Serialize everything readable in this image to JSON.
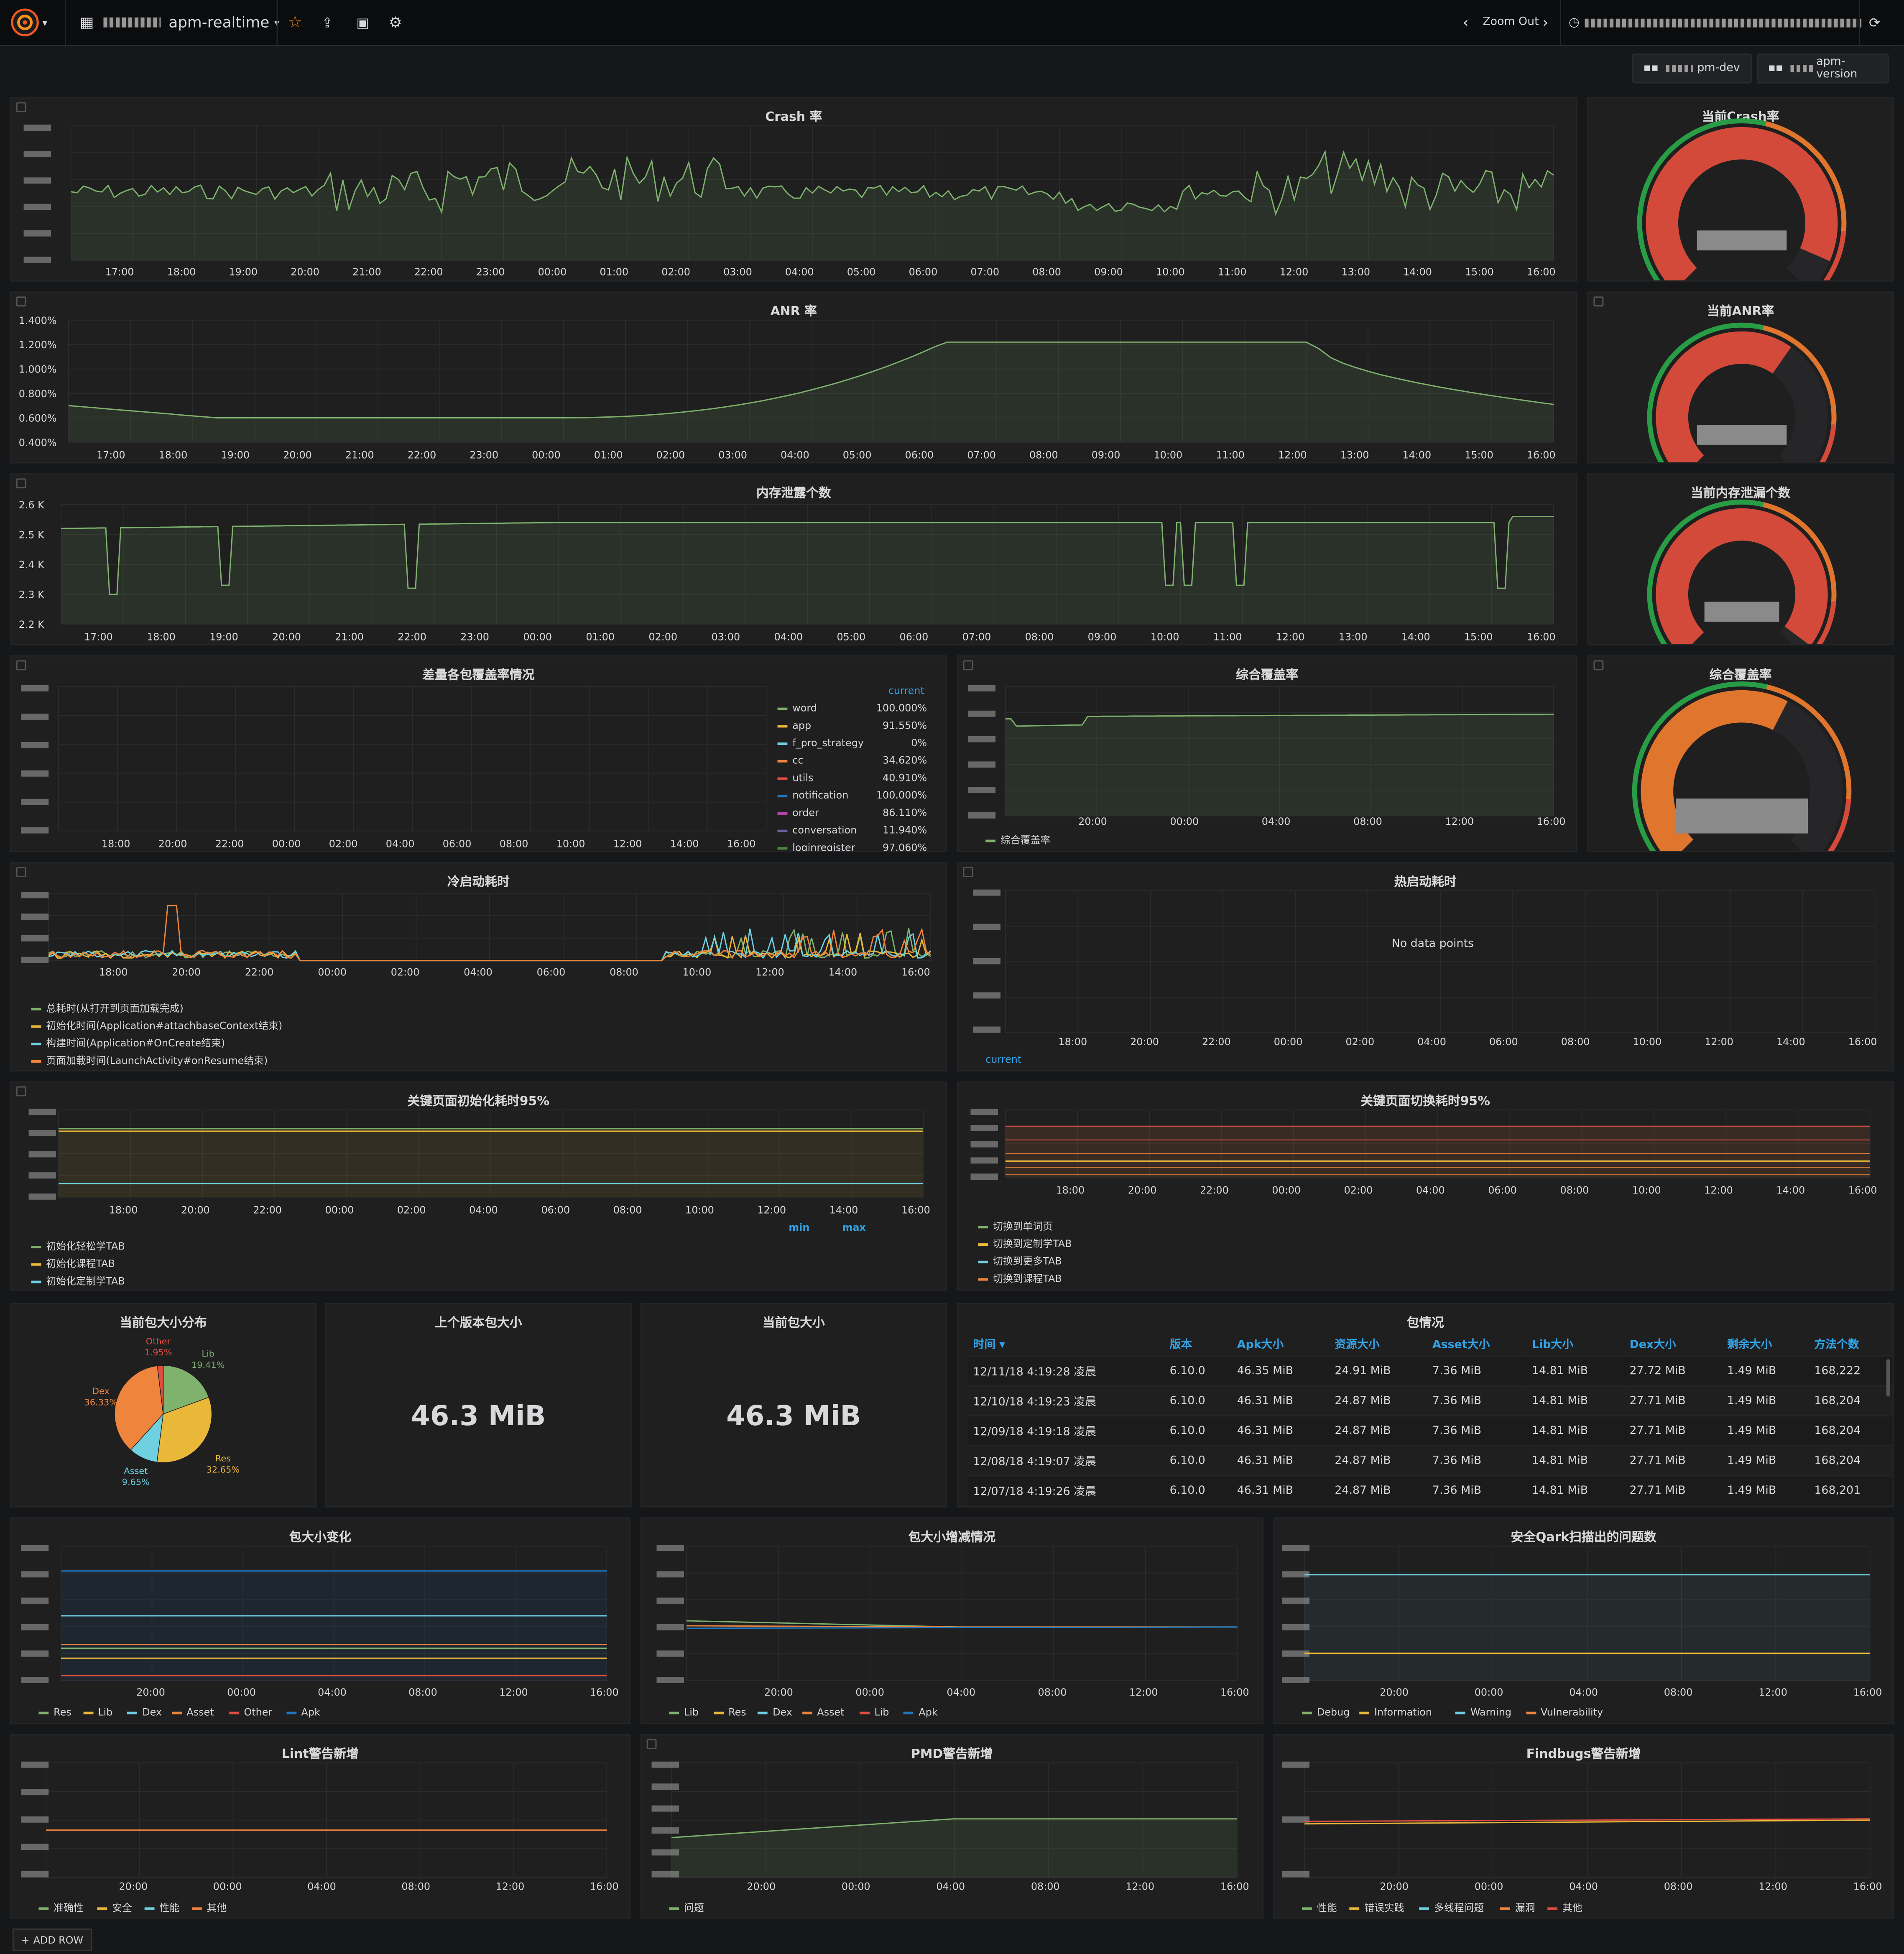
{
  "topbar": {
    "dashboard_title": "apm-realtime",
    "zoom_out": "Zoom Out"
  },
  "variables": [
    {
      "label": "pm-dev"
    },
    {
      "label": "apm-version"
    }
  ],
  "colors": {
    "green": "#7eb26d",
    "yellow": "#eab839",
    "cyan": "#6ed0e0",
    "orange": "#ef843c",
    "red": "#e24d42",
    "blue": "#1f78c1",
    "purple": "#ba43a9",
    "violet": "#705da0",
    "gauge_red": "#d44a3a",
    "gauge_orange": "#e0752d",
    "gauge_green": "#299c46",
    "accent": "#33a2e5"
  },
  "panels": {
    "crash": {
      "title": "Crash 率",
      "xticks": [
        "17:00",
        "18:00",
        "19:00",
        "20:00",
        "21:00",
        "22:00",
        "23:00",
        "00:00",
        "01:00",
        "02:00",
        "03:00",
        "04:00",
        "05:00",
        "06:00",
        "07:00",
        "08:00",
        "09:00",
        "10:00",
        "11:00",
        "12:00",
        "13:00",
        "14:00",
        "15:00",
        "16:00"
      ]
    },
    "crash_gauge": {
      "title": "当前Crash率",
      "value_fraction": 0.92
    },
    "anr": {
      "title": "ANR 率",
      "yticks": [
        "1.400%",
        "1.200%",
        "1.000%",
        "0.800%",
        "0.600%",
        "0.400%"
      ],
      "xticks": [
        "17:00",
        "18:00",
        "19:00",
        "20:00",
        "21:00",
        "22:00",
        "23:00",
        "00:00",
        "01:00",
        "02:00",
        "03:00",
        "04:00",
        "05:00",
        "06:00",
        "07:00",
        "08:00",
        "09:00",
        "10:00",
        "11:00",
        "12:00",
        "13:00",
        "14:00",
        "15:00",
        "16:00"
      ]
    },
    "anr_gauge": {
      "title": "当前ANR率",
      "value_fraction": 0.63
    },
    "memleak": {
      "title": "内存泄露个数",
      "yticks": [
        "2.6 K",
        "2.5 K",
        "2.4 K",
        "2.3 K",
        "2.2 K"
      ],
      "xticks": [
        "17:00",
        "18:00",
        "19:00",
        "20:00",
        "21:00",
        "22:00",
        "23:00",
        "00:00",
        "01:00",
        "02:00",
        "03:00",
        "04:00",
        "05:00",
        "06:00",
        "07:00",
        "08:00",
        "09:00",
        "10:00",
        "11:00",
        "12:00",
        "13:00",
        "14:00",
        "15:00",
        "16:00"
      ]
    },
    "memleak_gauge": {
      "title": "当前内存泄漏个数",
      "value_fraction": 0.97
    },
    "coverage_diff": {
      "title": "差量各包覆盖率情况",
      "legend_header": "current",
      "xticks": [
        "18:00",
        "20:00",
        "22:00",
        "00:00",
        "02:00",
        "04:00",
        "06:00",
        "08:00",
        "10:00",
        "12:00",
        "14:00",
        "16:00"
      ],
      "legend": [
        {
          "name": "word",
          "value": "100.000%",
          "color": "#7eb26d"
        },
        {
          "name": "app",
          "value": "91.550%",
          "color": "#eab839"
        },
        {
          "name": "f_pro_strategy",
          "value": "0%",
          "color": "#6ed0e0"
        },
        {
          "name": "cc",
          "value": "34.620%",
          "color": "#ef843c"
        },
        {
          "name": "utils",
          "value": "40.910%",
          "color": "#e24d42"
        },
        {
          "name": "notification",
          "value": "100.000%",
          "color": "#1f78c1"
        },
        {
          "name": "order",
          "value": "86.110%",
          "color": "#ba43a9"
        },
        {
          "name": "conversation",
          "value": "11.940%",
          "color": "#705da0"
        },
        {
          "name": "loginregister",
          "value": "97.060%",
          "color": "#508642"
        }
      ]
    },
    "coverage_total": {
      "title": "综合覆盖率",
      "xticks": [
        "20:00",
        "00:00",
        "04:00",
        "08:00",
        "12:00",
        "16:00"
      ],
      "legend": "综合覆盖率"
    },
    "coverage_gauge": {
      "title": "综合覆盖率",
      "value_fraction": 0.6
    },
    "cold_start": {
      "title": "冷启动耗时",
      "xticks": [
        "18:00",
        "20:00",
        "22:00",
        "00:00",
        "02:00",
        "04:00",
        "06:00",
        "08:00",
        "10:00",
        "12:00",
        "14:00",
        "16:00"
      ],
      "legend": [
        {
          "name": "总耗时(从打开到页面加载完成)",
          "color": "#7eb26d"
        },
        {
          "name": "初始化时间(Application#attachbaseContext结束)",
          "color": "#eab839"
        },
        {
          "name": "构建时间(Application#OnCreate结束)",
          "color": "#6ed0e0"
        },
        {
          "name": "页面加载时间(LaunchActivity#onResume结束)",
          "color": "#ef843c"
        }
      ]
    },
    "hot_start": {
      "title": "热启动耗时",
      "no_data": "No data points",
      "legend_header": "current",
      "xticks": [
        "18:00",
        "20:00",
        "22:00",
        "00:00",
        "02:00",
        "04:00",
        "06:00",
        "08:00",
        "10:00",
        "12:00",
        "14:00",
        "16:00"
      ]
    },
    "page_init": {
      "title": "关键页面初始化耗时95%",
      "xticks": [
        "18:00",
        "20:00",
        "22:00",
        "00:00",
        "02:00",
        "04:00",
        "06:00",
        "08:00",
        "10:00",
        "12:00",
        "14:00",
        "16:00"
      ],
      "headers": [
        "min",
        "max"
      ],
      "legend": [
        {
          "name": "初始化轻松学TAB",
          "color": "#7eb26d"
        },
        {
          "name": "初始化课程TAB",
          "color": "#eab839"
        },
        {
          "name": "初始化定制学TAB",
          "color": "#6ed0e0"
        }
      ]
    },
    "page_switch": {
      "title": "关键页面切换耗时95%",
      "xticks": [
        "18:00",
        "20:00",
        "22:00",
        "00:00",
        "02:00",
        "04:00",
        "06:00",
        "08:00",
        "10:00",
        "12:00",
        "14:00",
        "16:00"
      ],
      "legend": [
        {
          "name": "切换到单词页",
          "color": "#7eb26d"
        },
        {
          "name": "切换到定制学TAB",
          "color": "#eab839"
        },
        {
          "name": "切换到更多TAB",
          "color": "#6ed0e0"
        },
        {
          "name": "切换到课程TAB",
          "color": "#ef843c"
        }
      ]
    },
    "pkg_pie": {
      "title": "当前包大小分布",
      "slices": [
        {
          "name": "Lib",
          "value": 19.41,
          "label": "19.41%",
          "color": "#7eb26d"
        },
        {
          "name": "Res",
          "value": 32.65,
          "label": "32.65%",
          "color": "#eab839"
        },
        {
          "name": "Asset",
          "value": 9.65,
          "label": "9.65%",
          "color": "#6ed0e0"
        },
        {
          "name": "Dex",
          "value": 36.33,
          "label": "36.33%",
          "color": "#ef843c"
        },
        {
          "name": "Other",
          "value": 1.95,
          "label": "1.95%",
          "color": "#e24d42"
        }
      ]
    },
    "prev_pkg": {
      "title": "上个版本包大小",
      "value": "46.3 MiB"
    },
    "curr_pkg": {
      "title": "当前包大小",
      "value": "46.3 MiB"
    },
    "pkg_table": {
      "title": "包情况",
      "columns": [
        "时间 ▾",
        "版本",
        "Apk大小",
        "资源大小",
        "Asset大小",
        "Lib大小",
        "Dex大小",
        "剩余大小",
        "方法个数"
      ],
      "rows": [
        [
          "12/11/18 4:19:28 凌晨",
          "6.10.0",
          "46.35 MiB",
          "24.91 MiB",
          "7.36 MiB",
          "14.81 MiB",
          "27.72 MiB",
          "1.49 MiB",
          "168,222"
        ],
        [
          "12/10/18 4:19:23 凌晨",
          "6.10.0",
          "46.31 MiB",
          "24.87 MiB",
          "7.36 MiB",
          "14.81 MiB",
          "27.71 MiB",
          "1.49 MiB",
          "168,204"
        ],
        [
          "12/09/18 4:19:18 凌晨",
          "6.10.0",
          "46.31 MiB",
          "24.87 MiB",
          "7.36 MiB",
          "14.81 MiB",
          "27.71 MiB",
          "1.49 MiB",
          "168,204"
        ],
        [
          "12/08/18 4:19:07 凌晨",
          "6.10.0",
          "46.31 MiB",
          "24.87 MiB",
          "7.36 MiB",
          "14.81 MiB",
          "27.71 MiB",
          "1.49 MiB",
          "168,204"
        ],
        [
          "12/07/18 4:19:26 凌晨",
          "6.10.0",
          "46.31 MiB",
          "24.87 MiB",
          "7.36 MiB",
          "14.81 MiB",
          "27.71 MiB",
          "1.49 MiB",
          "168,201"
        ]
      ]
    },
    "pkg_change": {
      "title": "包大小变化",
      "xticks": [
        "20:00",
        "00:00",
        "04:00",
        "08:00",
        "12:00",
        "16:00"
      ],
      "legend": [
        {
          "name": "Res",
          "color": "#7eb26d"
        },
        {
          "name": "Lib",
          "color": "#eab839"
        },
        {
          "name": "Dex",
          "color": "#6ed0e0"
        },
        {
          "name": "Asset",
          "color": "#ef843c"
        },
        {
          "name": "Other",
          "color": "#e24d42"
        },
        {
          "name": "Apk",
          "color": "#1f78c1"
        }
      ]
    },
    "pkg_delta": {
      "title": "包大小增减情况",
      "xticks": [
        "20:00",
        "00:00",
        "04:00",
        "08:00",
        "12:00",
        "16:00"
      ],
      "legend": [
        {
          "name": "Lib",
          "color": "#7eb26d"
        },
        {
          "name": "Res",
          "color": "#eab839"
        },
        {
          "name": "Dex",
          "color": "#6ed0e0"
        },
        {
          "name": "Asset",
          "color": "#ef843c"
        },
        {
          "name": "Lib",
          "color": "#e24d42"
        },
        {
          "name": "Apk",
          "color": "#1f78c1"
        }
      ]
    },
    "qark": {
      "title": "安全Qark扫描出的问题数",
      "xticks": [
        "20:00",
        "00:00",
        "04:00",
        "08:00",
        "12:00",
        "16:00"
      ],
      "legend": [
        {
          "name": "Debug",
          "color": "#7eb26d"
        },
        {
          "name": "Information",
          "color": "#eab839"
        },
        {
          "name": "Warning",
          "color": "#6ed0e0"
        },
        {
          "name": "Vulnerability",
          "color": "#ef843c"
        }
      ]
    },
    "lint": {
      "title": "Lint警告新增",
      "xticks": [
        "20:00",
        "00:00",
        "04:00",
        "08:00",
        "12:00",
        "16:00"
      ],
      "legend": [
        {
          "name": "准确性",
          "color": "#7eb26d"
        },
        {
          "name": "安全",
          "color": "#eab839"
        },
        {
          "name": "性能",
          "color": "#6ed0e0"
        },
        {
          "name": "其他",
          "color": "#ef843c"
        }
      ]
    },
    "pmd": {
      "title": "PMD警告新增",
      "xticks": [
        "20:00",
        "00:00",
        "04:00",
        "08:00",
        "12:00",
        "16:00"
      ],
      "legend": [
        {
          "name": "问题",
          "color": "#7eb26d"
        }
      ]
    },
    "findbugs": {
      "title": "Findbugs警告新增",
      "xticks": [
        "20:00",
        "00:00",
        "04:00",
        "08:00",
        "12:00",
        "16:00"
      ],
      "legend": [
        {
          "name": "性能",
          "color": "#7eb26d"
        },
        {
          "name": "错误实践",
          "color": "#eab839"
        },
        {
          "name": "多线程问题",
          "color": "#6ed0e0"
        },
        {
          "name": "漏洞",
          "color": "#ef843c"
        },
        {
          "name": "其他",
          "color": "#e24d42"
        }
      ]
    }
  },
  "add_row": "ADD ROW"
}
